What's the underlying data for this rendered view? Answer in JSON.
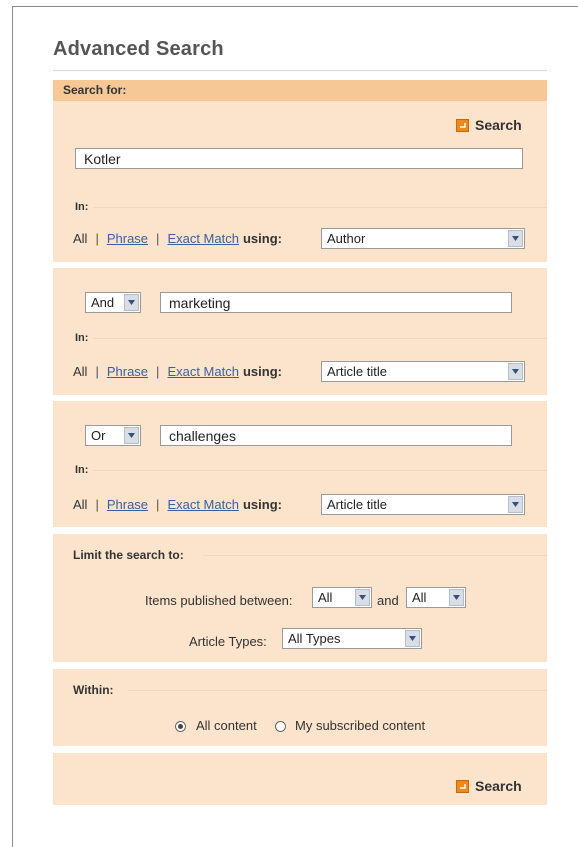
{
  "page": {
    "title": "Advanced Search"
  },
  "search_for": {
    "header": "Search for:",
    "search_label": "Search",
    "row1": {
      "query": "Kotler",
      "in_label": "In:",
      "opt_all": "All",
      "opt_phrase": "Phrase",
      "opt_exact": "Exact Match",
      "using_label": "using:",
      "field": "Author"
    },
    "row2": {
      "operator": "And",
      "query": "marketing",
      "in_label": "In:",
      "opt_all": "All",
      "opt_phrase": "Phrase",
      "opt_exact": "Exact Match",
      "using_label": "using:",
      "field": "Article title"
    },
    "row3": {
      "operator": "Or",
      "query": "challenges",
      "in_label": "In:",
      "opt_all": "All",
      "opt_phrase": "Phrase",
      "opt_exact": "Exact Match",
      "using_label": "using:",
      "field": "Article title"
    }
  },
  "limit": {
    "header": "Limit the search to:",
    "published_label": "Items published between:",
    "published_from": "All",
    "and_label": "and",
    "published_to": "All",
    "types_label": "Article Types:",
    "types_value": "All Types"
  },
  "within": {
    "header": "Within:",
    "option_all": "All content",
    "option_subscribed": "My subscribed content",
    "selected": "All content"
  },
  "footer": {
    "search_label": "Search"
  },
  "colors": {
    "panel_bg": "#fbe3cc",
    "header_bg": "#f5c896",
    "icon_orange": "#ee8a1d",
    "link": "#3b5fa0"
  }
}
